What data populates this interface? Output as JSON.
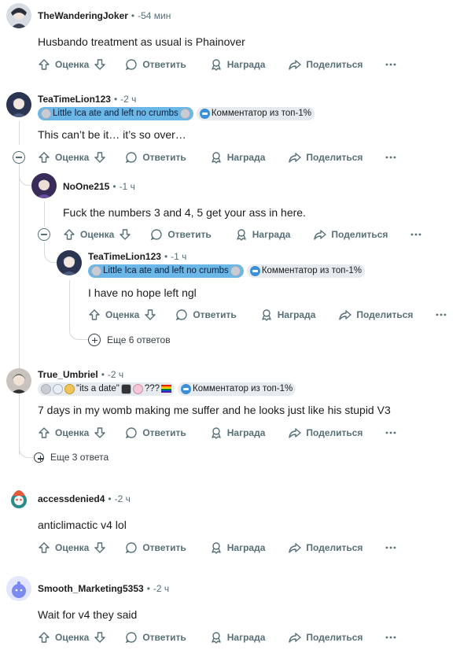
{
  "labels": {
    "vote": "Оценка",
    "reply": "Ответить",
    "award": "Награда",
    "share": "Поделиться",
    "dot": "•"
  },
  "comments": [
    {
      "username": "TheWanderingJoker",
      "time": "-54 мин",
      "text": "Husbando treatment as usual is Phainover",
      "avatar_icon": "anime-avatar-icon"
    },
    {
      "username": "TeaTimeLion123",
      "time": "-2 ч",
      "flair": "Little Ica ate and left no crumbs",
      "badge": "Комментатор из топ-1%",
      "text": "This can’t be it… it’s so over…",
      "avatar_icon": "anime-avatar-icon"
    },
    {
      "username": "NoOne215",
      "time": "-1 ч",
      "text": "Fuck the numbers 3 and 4, 5 get your ass in here.",
      "avatar_icon": "anime-avatar-icon"
    },
    {
      "username": "TeaTimeLion123",
      "time": "-1 ч",
      "flair": "Little Ica ate and left no crumbs",
      "badge": "Комментатор из топ-1%",
      "text": "I have no hope left ngl",
      "avatar_icon": "anime-avatar-icon"
    },
    {
      "username": "True_Umbriel",
      "time": "-2 ч",
      "flair_parts": [
        "\"its a date\"",
        "???"
      ],
      "badge": "Комментатор из топ-1%",
      "text": "7 days in my womb making me suffer and he looks just like his stupid V3",
      "avatar_icon": "anime-avatar-icon"
    },
    {
      "username": "accessdenied4",
      "time": "-2 ч",
      "text": "anticlimactic v4 lol",
      "avatar_icon": "snoo-avatar-icon"
    },
    {
      "username": "Smooth_Marketing5353",
      "time": "-2 ч",
      "text": "Wait for v4 they said",
      "avatar_icon": "snoo-avatar-icon"
    }
  ],
  "more_replies": {
    "six": "Еще 6 ответов",
    "three": "Еще 3 ответа"
  }
}
